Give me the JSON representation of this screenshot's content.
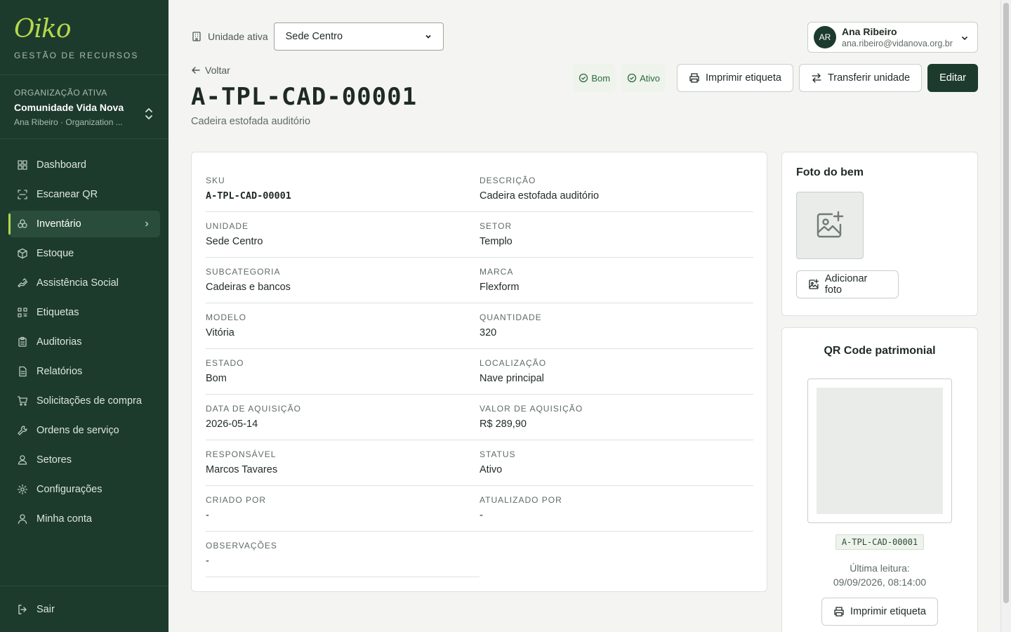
{
  "brand": {
    "logo": "Oiko",
    "subtitle": "GESTÃO DE RECURSOS"
  },
  "org": {
    "label": "ORGANIZAÇÃO ATIVA",
    "name": "Comunidade Vida Nova",
    "user": "Ana Ribeiro · Organization ..."
  },
  "nav": [
    {
      "label": "Dashboard",
      "icon": "dashboard-icon"
    },
    {
      "label": "Escanear QR",
      "icon": "scan-icon"
    },
    {
      "label": "Inventário",
      "icon": "inventory-icon",
      "active": true
    },
    {
      "label": "Estoque",
      "icon": "box-icon"
    },
    {
      "label": "Assistência Social",
      "icon": "hand-icon"
    },
    {
      "label": "Etiquetas",
      "icon": "qr-icon"
    },
    {
      "label": "Auditorias",
      "icon": "clipboard-icon"
    },
    {
      "label": "Relatórios",
      "icon": "report-icon"
    },
    {
      "label": "Solicitações de compra",
      "icon": "cart-icon"
    },
    {
      "label": "Ordens de serviço",
      "icon": "wrench-icon"
    },
    {
      "label": "Setores",
      "icon": "sectors-icon"
    },
    {
      "label": "Configurações",
      "icon": "gear-icon"
    },
    {
      "label": "Minha conta",
      "icon": "user-icon"
    }
  ],
  "logout": "Sair",
  "header": {
    "unit_label": "Unidade ativa",
    "unit_value": "Sede Centro",
    "user_initials": "AR",
    "user_name": "Ana Ribeiro",
    "user_email": "ana.ribeiro@vidanova.org.br"
  },
  "page": {
    "back": "Voltar",
    "title": "A-TPL-CAD-00001",
    "subtitle": "Cadeira estofada auditório",
    "badges": [
      "Bom",
      "Ativo"
    ],
    "print_label": "Imprimir etiqueta",
    "transfer_label": "Transferir unidade",
    "edit_label": "Editar"
  },
  "fields": [
    {
      "label": "SKU",
      "value": "A-TPL-CAD-00001",
      "mono": true
    },
    {
      "label": "DESCRIÇÃO",
      "value": "Cadeira estofada auditório"
    },
    {
      "label": "UNIDADE",
      "value": "Sede Centro"
    },
    {
      "label": "SETOR",
      "value": "Templo"
    },
    {
      "label": "SUBCATEGORIA",
      "value": "Cadeiras e bancos"
    },
    {
      "label": "MARCA",
      "value": "Flexform"
    },
    {
      "label": "MODELO",
      "value": "Vitória"
    },
    {
      "label": "QUANTIDADE",
      "value": "320"
    },
    {
      "label": "ESTADO",
      "value": "Bom"
    },
    {
      "label": "LOCALIZAÇÃO",
      "value": "Nave principal"
    },
    {
      "label": "DATA DE AQUISIÇÃO",
      "value": "2026-05-14"
    },
    {
      "label": "VALOR DE AQUISIÇÃO",
      "value": "R$ 289,90"
    },
    {
      "label": "RESPONSÁVEL",
      "value": "Marcos Tavares"
    },
    {
      "label": "STATUS",
      "value": "Ativo"
    },
    {
      "label": "CRIADO POR",
      "value": "-"
    },
    {
      "label": "ATUALIZADO POR",
      "value": "-"
    },
    {
      "label": "OBSERVAÇÕES",
      "value": "-"
    }
  ],
  "photo": {
    "title": "Foto do bem",
    "add_label": "Adicionar foto"
  },
  "qr": {
    "title": "QR Code patrimonial",
    "code": "A-TPL-CAD-00001",
    "last_read_label": "Última leitura:",
    "last_read_value": "09/09/2026, 08:14:00",
    "print_label": "Imprimir etiqueta"
  }
}
